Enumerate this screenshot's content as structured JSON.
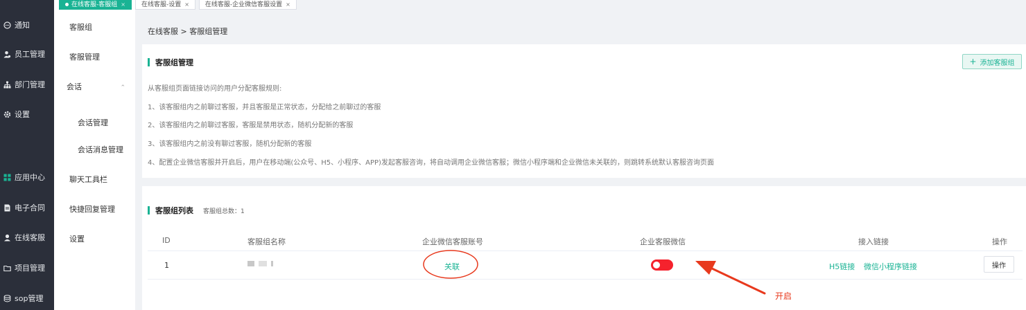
{
  "tabs": [
    {
      "label": "在线客服-客服组",
      "active": true
    },
    {
      "label": "在线客服-设置",
      "active": false
    },
    {
      "label": "在线客服-企业微信客服设置",
      "active": false
    }
  ],
  "main_nav": [
    {
      "label": "通知",
      "icon": "chat-bubble-icon"
    },
    {
      "label": "员工管理",
      "icon": "user-group-icon"
    },
    {
      "label": "部门管理",
      "icon": "org-chart-icon"
    },
    {
      "label": "设置",
      "icon": "gear-icon"
    },
    {
      "label": "应用中心",
      "icon": "app-grid-icon"
    },
    {
      "label": "电子合同",
      "icon": "document-icon"
    },
    {
      "label": "在线客服",
      "icon": "headset-icon"
    },
    {
      "label": "项目管理",
      "icon": "folder-icon"
    },
    {
      "label": "sop管理",
      "icon": "database-icon"
    }
  ],
  "sub_nav": [
    {
      "label": "客服组"
    },
    {
      "label": "客服管理"
    },
    {
      "label": "会话"
    },
    {
      "label": "会话管理"
    },
    {
      "label": "会话消息管理"
    },
    {
      "label": "聊天工具栏"
    },
    {
      "label": "快捷回复管理"
    },
    {
      "label": "设置"
    }
  ],
  "breadcrumb": "在线客服 > 客服组管理",
  "group_manage": {
    "title": "客服组管理",
    "add_button": "添加客服组",
    "rules": [
      "从客服组页面链接访问的用户分配客服规则:",
      "1、该客服组内之前聊过客服，并且客服是正常状态，分配给之前聊过的客服",
      "2、该客服组内之前聊过客服，客服是禁用状态，随机分配新的客服",
      "3、该客服组内之前没有聊过客服，随机分配新的客服",
      "4、配置企业微信客服并开启后，用户在移动端(公众号、H5、小程序、APP)发起客服咨询，将自动调用企业微信客服；微信小程序端和企业微信未关联的，则跳转系统默认客服咨询页面"
    ]
  },
  "group_list": {
    "title": "客服组列表",
    "count_label": "客服组总数：1",
    "columns": [
      "ID",
      "客服组名称",
      "企业微信客服账号",
      "企业客服微信",
      "接入链接",
      "操作"
    ],
    "rows": [
      {
        "id": "1",
        "wecom_account": "关联",
        "wecom_enabled": true,
        "links": [
          "H5链接",
          "微信小程序链接"
        ],
        "action": "操作"
      }
    ]
  },
  "annotation": {
    "label": "开启",
    "color": "#e8391d"
  },
  "colors": {
    "accent": "#1ab394",
    "sidebar": "#2b2f3a",
    "toggle_on": "#f5222d"
  }
}
